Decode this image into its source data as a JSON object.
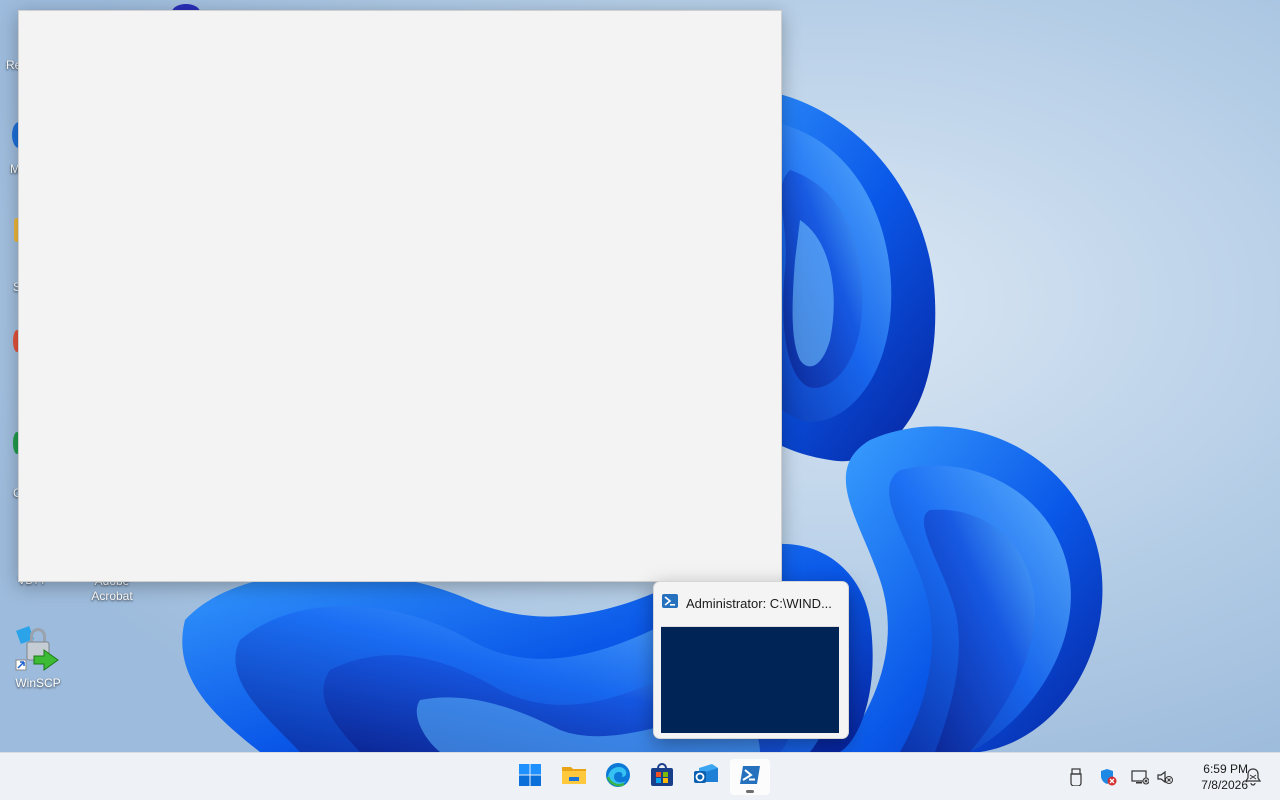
{
  "desktop": {
    "icons": {
      "acrobat": "Adobe\nAcrobat",
      "winscp": "WinSCP"
    },
    "edge_fragments": [
      "Re",
      "M",
      "S",
      "C",
      "VBTT"
    ]
  },
  "thumbnail": {
    "title": "Administrator: C:\\WIND...",
    "app_icon": "powershell-icon"
  },
  "taskbar": {
    "apps": [
      {
        "name": "start",
        "icon": "windows-logo-icon"
      },
      {
        "name": "file-explorer",
        "icon": "folder-icon"
      },
      {
        "name": "edge",
        "icon": "edge-icon"
      },
      {
        "name": "store",
        "icon": "store-icon"
      },
      {
        "name": "outlook",
        "icon": "outlook-icon"
      },
      {
        "name": "powershell",
        "icon": "powershell-icon",
        "active": true
      }
    ],
    "tray": [
      "usb-icon",
      "security-shield-icon",
      "network-icon",
      "volume-muted-icon"
    ],
    "clock": {
      "time": "6:59 PM",
      "date": "7/8/2026"
    },
    "notification_icon": "notification-bell-icon"
  },
  "colors": {
    "accent": "#0067c0",
    "powershell_bg": "#012456",
    "taskbar_bg": "#eef1f6",
    "window_bg": "#f3f3f3"
  }
}
